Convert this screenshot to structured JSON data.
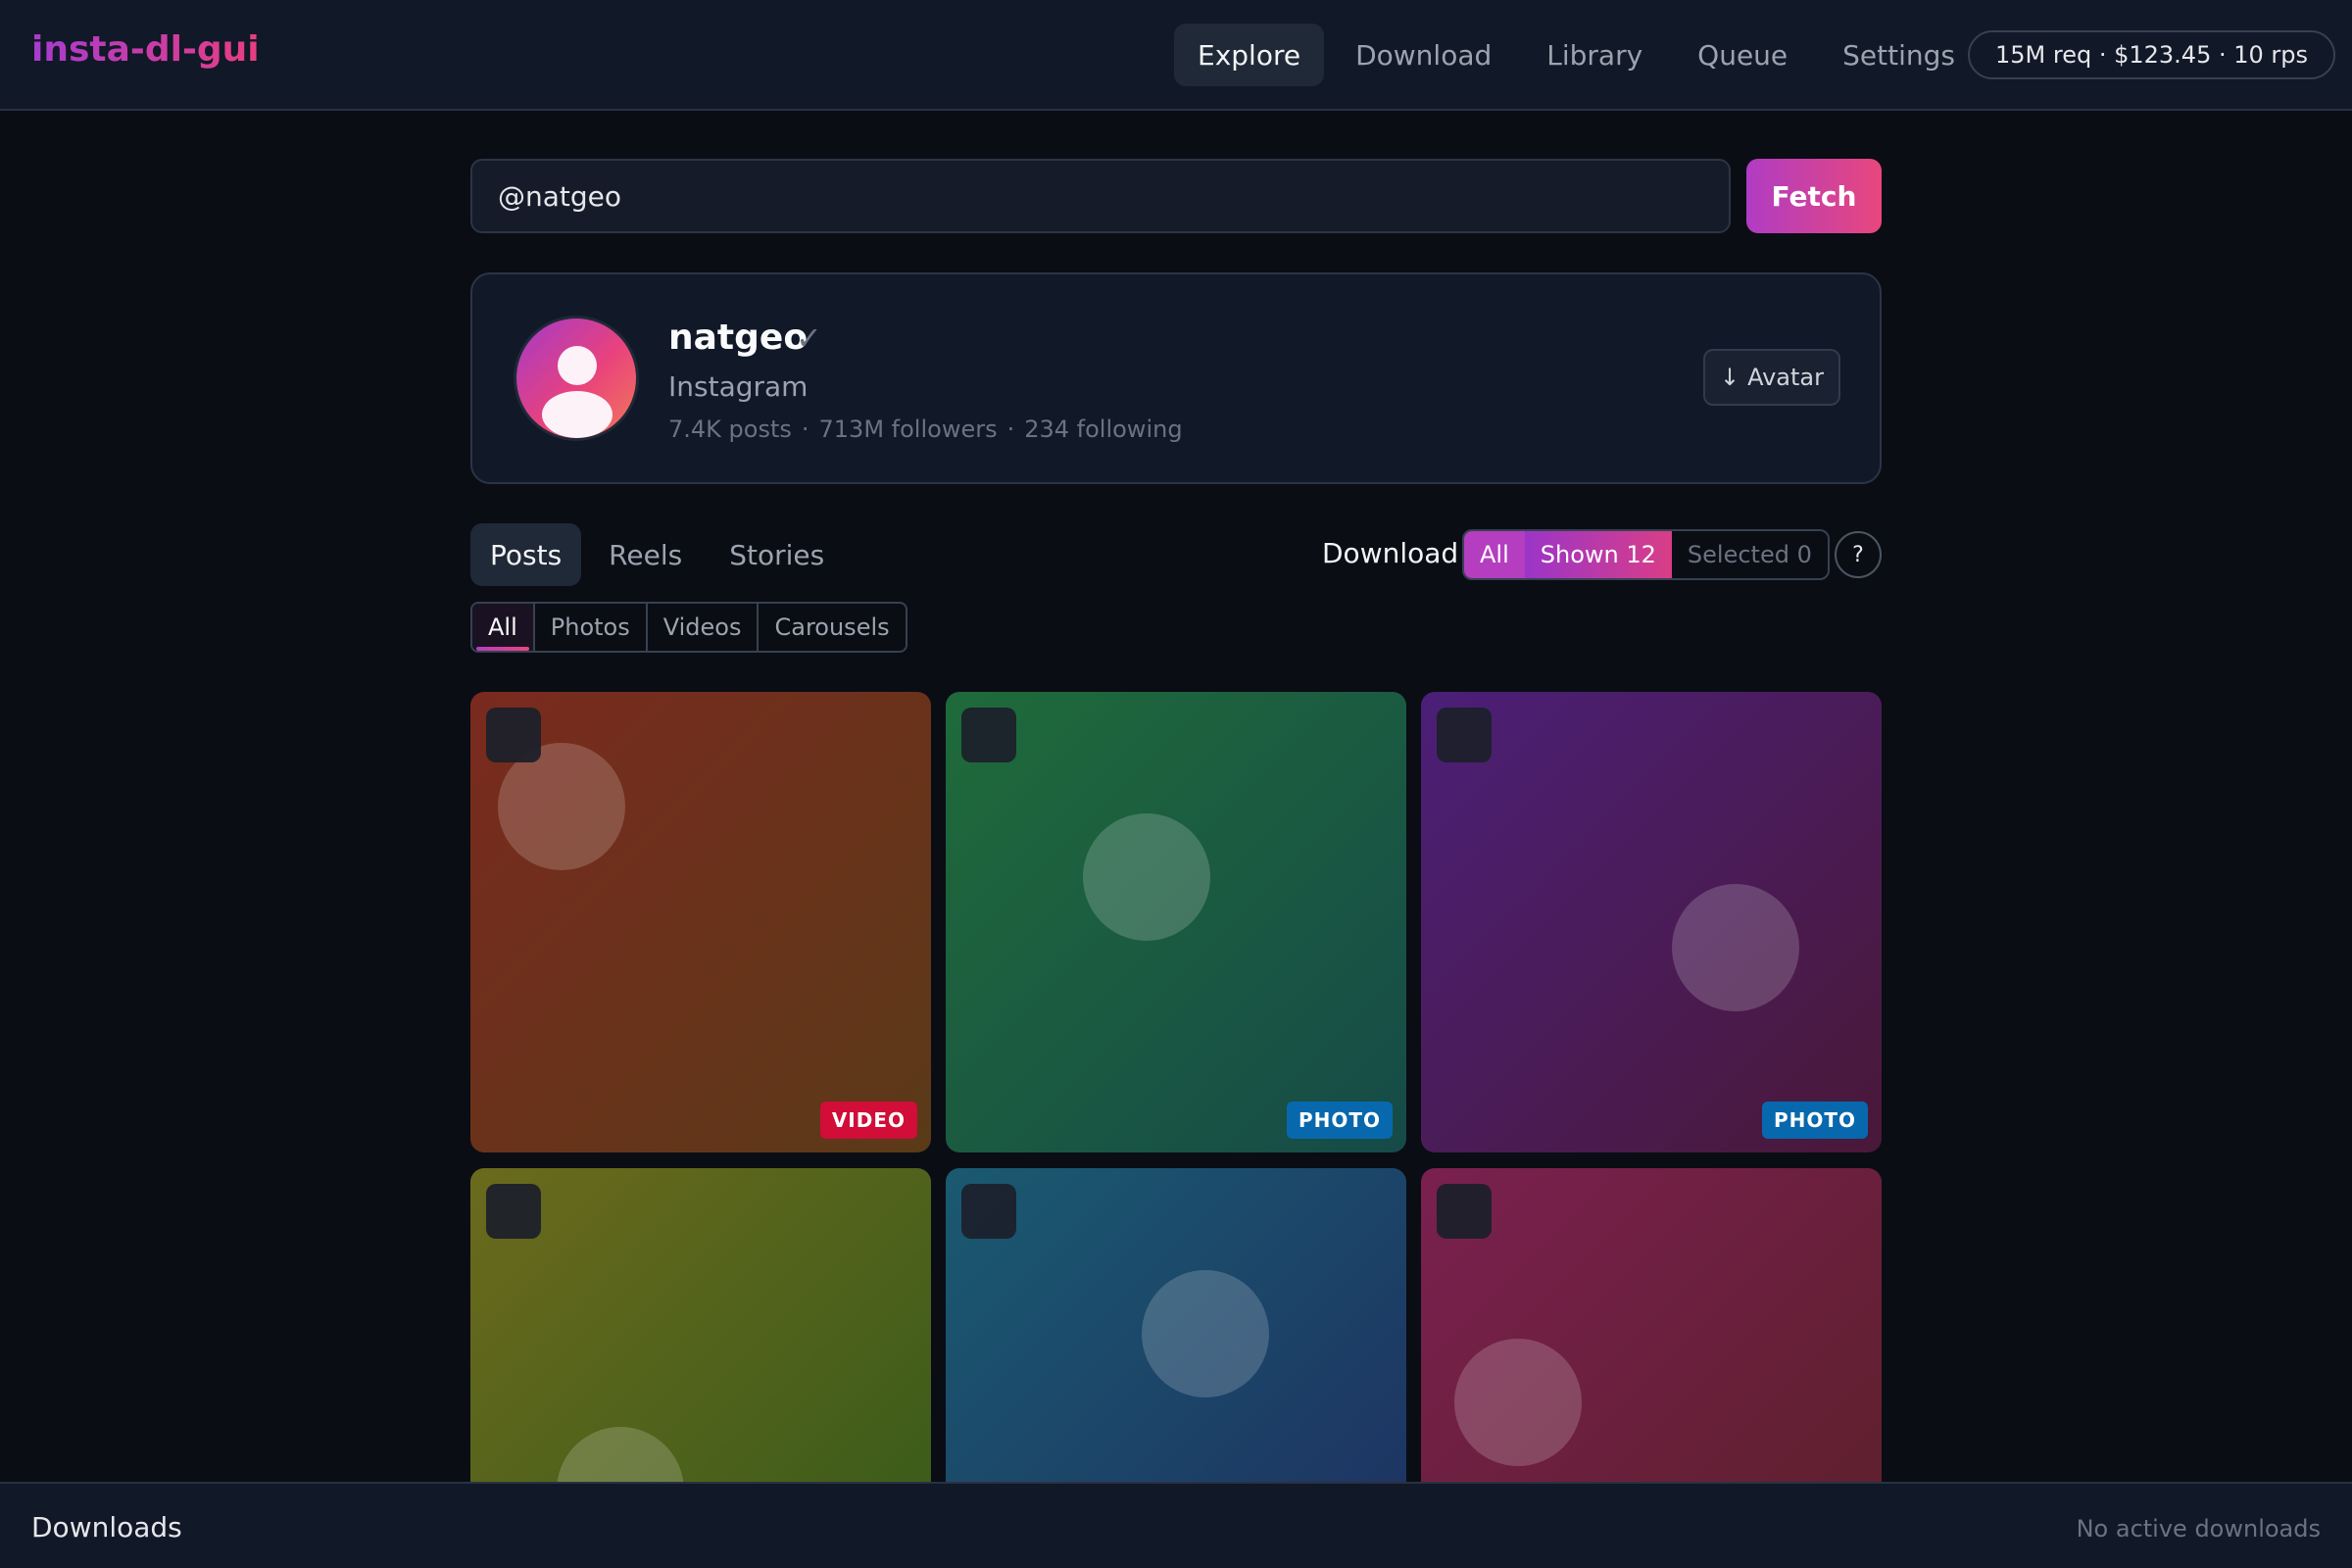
{
  "app": {
    "title": "insta-dl-gui"
  },
  "nav": {
    "items": [
      "Explore",
      "Download",
      "Library",
      "Queue",
      "Settings"
    ],
    "active": "Explore"
  },
  "quota": {
    "text": "15M req · $123.45 · 10 rps"
  },
  "search": {
    "value": "@natgeo",
    "button_label": "Fetch"
  },
  "profile": {
    "username": "natgeo",
    "verified_glyph": "✓",
    "full_name": "Instagram",
    "posts": "7.4K posts",
    "followers": "713M followers",
    "following": "234 following",
    "separator": "·",
    "avatar_button": "Avatar",
    "avatar_button_icon": "↓"
  },
  "tabs": {
    "items": [
      "Posts",
      "Reels",
      "Stories"
    ],
    "active": "Posts"
  },
  "download": {
    "label": "Download",
    "all": "All",
    "shown": "Shown 12",
    "selected": "Selected 0",
    "help": "?"
  },
  "filters": {
    "items": [
      "All",
      "Photos",
      "Videos",
      "Carousels"
    ],
    "active": "All"
  },
  "grid": {
    "tiles": [
      {
        "badge": "VIDEO",
        "kind": "video",
        "colors": [
          "#7a2a1e",
          "#5a3a18"
        ]
      },
      {
        "badge": "PHOTO",
        "kind": "photo",
        "colors": [
          "#1f6b3a",
          "#164a48"
        ]
      },
      {
        "badge": "PHOTO",
        "kind": "photo",
        "colors": [
          "#4b1f78",
          "#4a1838"
        ]
      },
      {
        "badge": "",
        "kind": "",
        "colors": [
          "#6b6a1c",
          "#345a1a"
        ]
      },
      {
        "badge": "",
        "kind": "",
        "colors": [
          "#1a5a70",
          "#1e2e60"
        ]
      },
      {
        "badge": "",
        "kind": "",
        "colors": [
          "#7a2050",
          "#5a2028"
        ]
      }
    ]
  },
  "downloads": {
    "title": "Downloads",
    "status": "No active downloads"
  }
}
